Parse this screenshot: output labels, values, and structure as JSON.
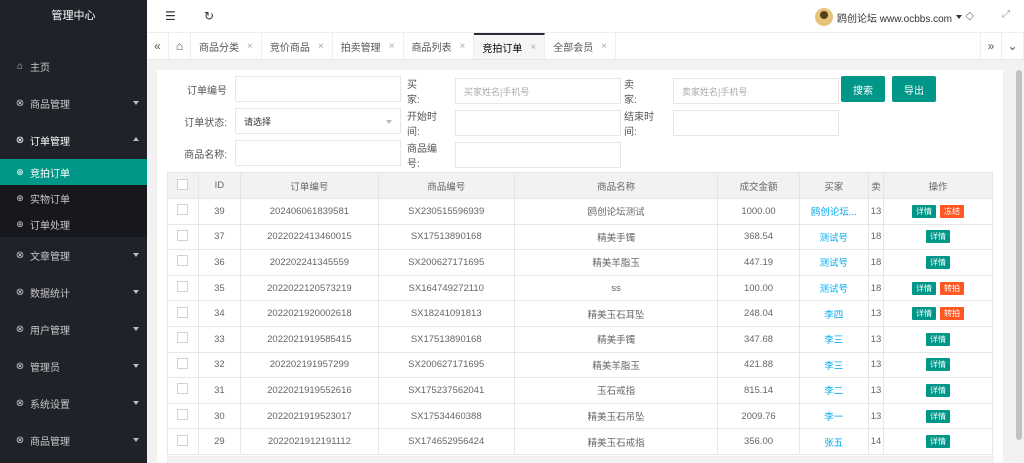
{
  "sidebar": {
    "title": "管理中心",
    "items": [
      {
        "label": "主页",
        "icon": "home-icon",
        "glyph": "⌂",
        "expandable": false
      },
      {
        "label": "商品管理",
        "icon": "box-icon",
        "glyph": "⊗",
        "expandable": true
      },
      {
        "label": "订单管理",
        "icon": "box-icon",
        "glyph": "⊗",
        "expandable": true,
        "open": true,
        "children": [
          {
            "label": "竞拍订单",
            "active": true
          },
          {
            "label": "实物订单"
          },
          {
            "label": "订单处理"
          }
        ]
      },
      {
        "label": "文章管理",
        "icon": "box-icon",
        "glyph": "⊗",
        "expandable": true
      },
      {
        "label": "数据统计",
        "icon": "box-icon",
        "glyph": "⊗",
        "expandable": true
      },
      {
        "label": "用户管理",
        "icon": "box-icon",
        "glyph": "⊗",
        "expandable": true
      },
      {
        "label": "管理员",
        "icon": "box-icon",
        "glyph": "⊗",
        "expandable": true
      },
      {
        "label": "系统设置",
        "icon": "box-icon",
        "glyph": "⊗",
        "expandable": true
      },
      {
        "label": "商品管理",
        "icon": "box-icon",
        "glyph": "⊗",
        "expandable": true
      }
    ]
  },
  "header": {
    "user_name": "鸥创论坛 www.ocbbs.com"
  },
  "tabs": {
    "items": [
      {
        "label": "商品分类",
        "active": false
      },
      {
        "label": "竞价商品",
        "active": false
      },
      {
        "label": "拍卖管理",
        "active": false
      },
      {
        "label": "商品列表",
        "active": false
      },
      {
        "label": "竞拍订单",
        "active": true
      },
      {
        "label": "全部会员",
        "active": false
      }
    ]
  },
  "filters": {
    "order_no_label": "订单编号",
    "buyer_label": "买　　家:",
    "buyer_placeholder": "买家姓名|手机号",
    "seller_label": "卖　　家:",
    "seller_placeholder": "卖家姓名|手机号",
    "search_button": "搜索",
    "export_button": "导出",
    "status_label": "订单状态:",
    "status_value": "请选择",
    "start_label": "开始时间:",
    "end_label": "结束时间:",
    "goods_name_label": "商品名称:",
    "goods_no_label": "商品编号:"
  },
  "table": {
    "columns": [
      "ID",
      "订单编号",
      "商品编号",
      "商品名称",
      "成交金额",
      "买家",
      "卖",
      "操作"
    ],
    "rows": [
      {
        "id": "39",
        "order_no": "202406061839581",
        "goods_no": "SX230515596939",
        "name": "鸥创论坛测试",
        "amount": "1000.00",
        "buyer": "鸥创论坛...",
        "seller": "13",
        "ops": [
          "详情",
          "冻结"
        ]
      },
      {
        "id": "37",
        "order_no": "2022022413460015",
        "goods_no": "SX17513890168",
        "name": "精美手镯",
        "amount": "368.54",
        "buyer": "测试号",
        "seller": "18",
        "ops": [
          "详情"
        ]
      },
      {
        "id": "36",
        "order_no": "202202241345559",
        "goods_no": "SX200627171695",
        "name": "精美羊脂玉",
        "amount": "447.19",
        "buyer": "测试号",
        "seller": "18",
        "ops": [
          "详情"
        ]
      },
      {
        "id": "35",
        "order_no": "2022022120573219",
        "goods_no": "SX164749272110",
        "name": "ss",
        "amount": "100.00",
        "buyer": "测试号",
        "seller": "18",
        "ops": [
          "详情",
          "转拍"
        ]
      },
      {
        "id": "34",
        "order_no": "2022021920002618",
        "goods_no": "SX18241091813",
        "name": "精美玉石耳坠",
        "amount": "248.04",
        "buyer": "李四",
        "seller": "13",
        "ops": [
          "详情",
          "转拍"
        ]
      },
      {
        "id": "33",
        "order_no": "202202191958541​5",
        "goods_no": "SX17513890168",
        "name": "精美手镯",
        "amount": "347.68",
        "buyer": "李三",
        "seller": "13",
        "ops": [
          "详情"
        ]
      },
      {
        "id": "32",
        "order_no": "202202191957299",
        "goods_no": "SX200627171695",
        "name": "精美羊脂玉",
        "amount": "421.88",
        "buyer": "李三",
        "seller": "13",
        "ops": [
          "详情"
        ]
      },
      {
        "id": "31",
        "order_no": "2022021919552616",
        "goods_no": "SX175237562041",
        "name": "玉石戒指",
        "amount": "815.14",
        "buyer": "李二",
        "seller": "13",
        "ops": [
          "详情"
        ]
      },
      {
        "id": "30",
        "order_no": "2022021919523017",
        "goods_no": "SX17534460388",
        "name": "精美玉石吊坠",
        "amount": "2009.76",
        "buyer": "李一",
        "seller": "13",
        "ops": [
          "详情"
        ]
      },
      {
        "id": "29",
        "order_no": "2022021912191112",
        "goods_no": "SX174652956424",
        "name": "精美玉石戒指",
        "amount": "356.00",
        "buyer": "张五",
        "seller": "14",
        "ops": [
          "详情"
        ]
      }
    ]
  },
  "colors": {
    "sidebar_bg": "#20222a",
    "accent": "#009688",
    "danger": "#ff5722",
    "link": "#01aaed"
  }
}
